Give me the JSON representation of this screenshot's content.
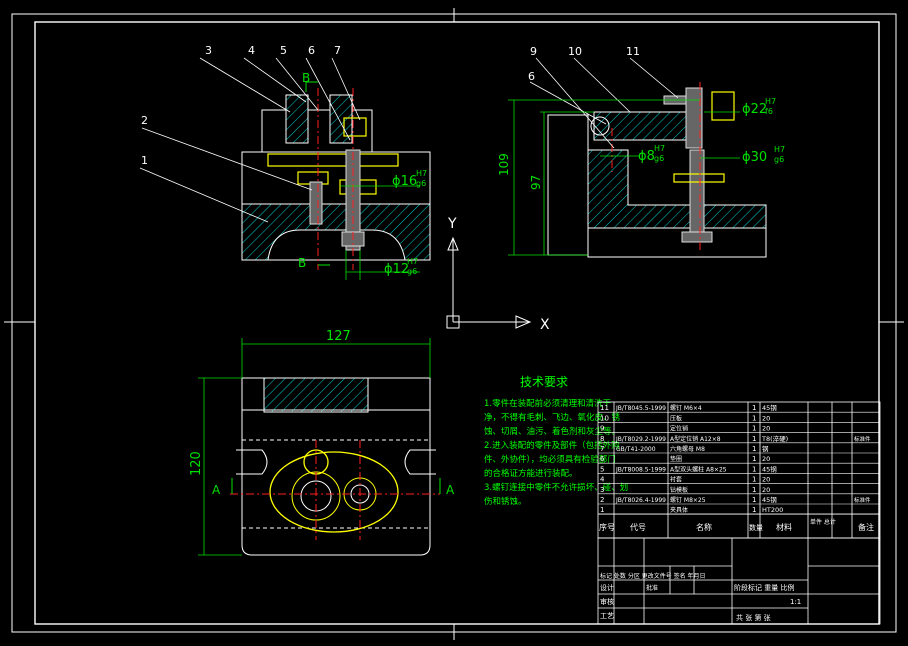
{
  "drawing": {
    "background": "#000000",
    "line_color": "#ffffff",
    "hatch_color": "#00d0d0",
    "dim_color": "#00e000",
    "center_color": "#ff2020",
    "part_color": "#ffff00",
    "text_color": "#00ff00"
  },
  "balloons": {
    "front": [
      "1",
      "2",
      "3",
      "4",
      "5",
      "6",
      "7"
    ],
    "side": [
      "6",
      "9",
      "10",
      "11"
    ]
  },
  "section_marks": {
    "b_top": "B",
    "b_bottom": "B",
    "a_left": "A",
    "a_right": "A"
  },
  "dimensions": {
    "front_d16": "ϕ16",
    "front_d16_tol_top": "H7",
    "front_d16_tol_bot": "g6",
    "front_d12": "ϕ12",
    "front_d12_tol_top": "H7",
    "front_d12_tol_bot": "g6",
    "side_109": "109",
    "side_97": "97",
    "side_d22": "ϕ22",
    "side_d22_tol_top": "H7",
    "side_d22_tol_bot": "f6",
    "side_d8": "ϕ8",
    "side_d8_tol_top": "H7",
    "side_d8_tol_bot": "g6",
    "side_d30": "ϕ30",
    "side_d30_tol_top": "H7",
    "side_d30_tol_bot": "g6",
    "plan_127": "127",
    "plan_120": "120"
  },
  "ucs": {
    "x": "X",
    "y": "Y"
  },
  "tech_req": {
    "title": "技术要求",
    "lines": [
      "1.零件在装配前必须清理和清洗干",
      "净，不得有毛刺、飞边、氧化皮、锈",
      "蚀、切屑、油污、着色剂和灰尘等。",
      "2.进入装配的零件及部件（包括外购",
      "件、外协件），均必须具有检验部门",
      "的合格证方能进行装配。",
      "3.螺钉连接中零件不允许损坏、碰、划",
      "伤和锈蚀。"
    ]
  },
  "bom": {
    "rows": [
      {
        "no": "11",
        "code": "JB/T8045.5-1999",
        "name": "螺钉 M6×4",
        "qty": "1",
        "mat": "45钢",
        "note": ""
      },
      {
        "no": "10",
        "code": "",
        "name": "压板",
        "qty": "1",
        "mat": "20",
        "note": ""
      },
      {
        "no": "9",
        "code": "",
        "name": "定位销",
        "qty": "1",
        "mat": "20",
        "note": ""
      },
      {
        "no": "8",
        "code": "JB/T8029.2-1999",
        "name": "A型定位销 A12×8",
        "qty": "1",
        "mat": "T8(淬硬)",
        "note": "标准件"
      },
      {
        "no": "7",
        "code": "GB/T41-2000",
        "name": "六角螺母 M8",
        "qty": "1",
        "mat": "钢",
        "note": ""
      },
      {
        "no": "6",
        "code": "",
        "name": "垫圈",
        "qty": "1",
        "mat": "20",
        "note": ""
      },
      {
        "no": "5",
        "code": "JB/T8008.5-1999",
        "name": "A型双头螺柱 A8×25",
        "qty": "1",
        "mat": "45钢",
        "note": ""
      },
      {
        "no": "4",
        "code": "",
        "name": "衬套",
        "qty": "1",
        "mat": "20",
        "note": ""
      },
      {
        "no": "3",
        "code": "",
        "name": "钻模板",
        "qty": "1",
        "mat": "20",
        "note": ""
      },
      {
        "no": "2",
        "code": "JB/T8026.4-1999",
        "name": "螺钉 M8×25",
        "qty": "1",
        "mat": "45钢",
        "note": "标准件"
      },
      {
        "no": "1",
        "code": "",
        "name": "夹具体",
        "qty": "1",
        "mat": "HT200",
        "note": ""
      }
    ],
    "header": {
      "no": "序号",
      "code": "代号",
      "name": "名称",
      "qty": "数量",
      "mat": "材料",
      "weight": "单件 总计",
      "note": "备注"
    }
  },
  "title_block": {
    "design": "设计",
    "check": "审核",
    "process": "工艺",
    "approve": "批准",
    "rev_cols": "标记 处数 分区 更改文件号 签名 年月日",
    "stage": "阶段标记 重量 比例",
    "scale": "1:1",
    "sheets": "共 张 第 张"
  }
}
